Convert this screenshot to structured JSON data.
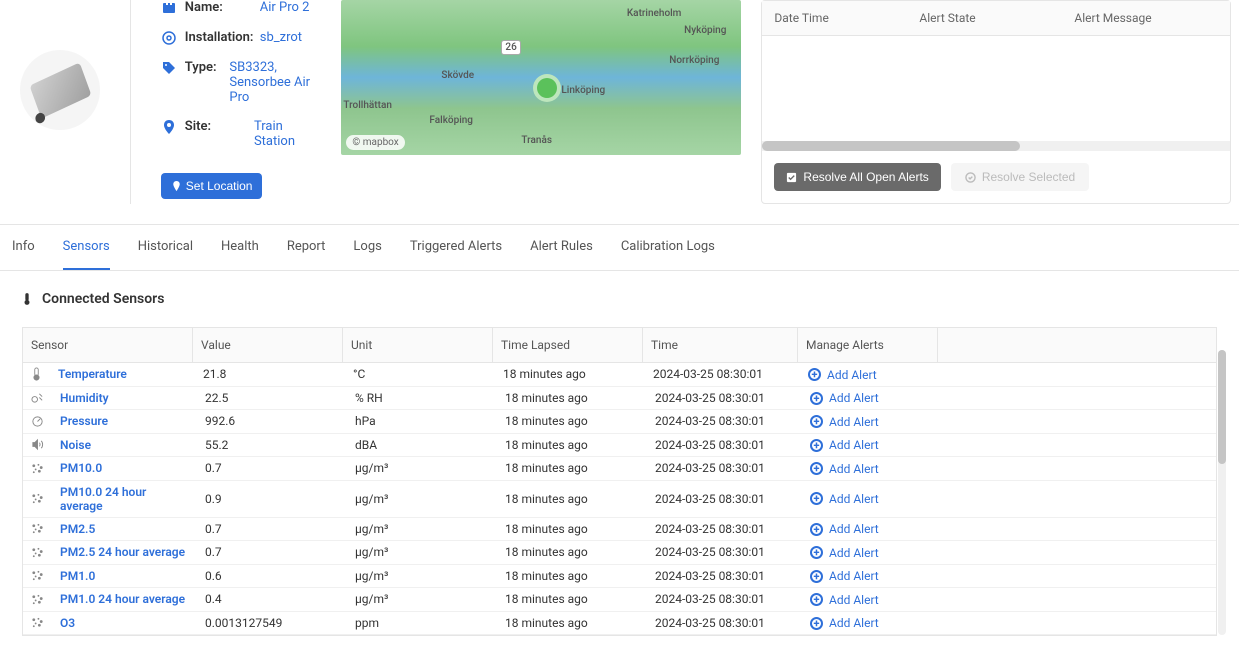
{
  "device": {
    "name_label": "Name:",
    "name": "Air Pro 2",
    "installation_label": "Installation:",
    "installation": "sb_zrot",
    "type_label": "Type:",
    "type": "SB3323, Sensorbee Air Pro",
    "site_label": "Site:",
    "site": "Train Station",
    "set_location_btn": "Set Location"
  },
  "map": {
    "attribution": "© mapbox",
    "cities": [
      "Nyköping",
      "Norrköping",
      "Linköping",
      "Skövde",
      "Falköping",
      "Trollhättan",
      "Tranås",
      "Katrineholm",
      "26"
    ]
  },
  "alerts_panel": {
    "col_datetime": "Date Time",
    "col_state": "Alert State",
    "col_message": "Alert Message",
    "resolve_all": "Resolve All Open Alerts",
    "resolve_selected": "Resolve Selected"
  },
  "tabs": {
    "info": "Info",
    "sensors": "Sensors",
    "historical": "Historical",
    "health": "Health",
    "report": "Report",
    "logs": "Logs",
    "triggered": "Triggered Alerts",
    "rules": "Alert Rules",
    "calibration": "Calibration Logs"
  },
  "sensors_section": {
    "title": "Connected Sensors",
    "headers": {
      "sensor": "Sensor",
      "value": "Value",
      "unit": "Unit",
      "lapsed": "Time Lapsed",
      "time": "Time",
      "manage": "Manage Alerts"
    },
    "add_alert_label": "Add Alert",
    "rows": [
      {
        "icon": "therm",
        "name": "Temperature",
        "value": "21.8",
        "unit": "°C",
        "lapsed": "18 minutes ago",
        "time": "2024-03-25 08:30:01"
      },
      {
        "icon": "drop",
        "name": "Humidity",
        "value": "22.5",
        "unit": "% RH",
        "lapsed": "18 minutes ago",
        "time": "2024-03-25 08:30:01"
      },
      {
        "icon": "gauge",
        "name": "Pressure",
        "value": "992.6",
        "unit": "hPa",
        "lapsed": "18 minutes ago",
        "time": "2024-03-25 08:30:01"
      },
      {
        "icon": "sound",
        "name": "Noise",
        "value": "55.2",
        "unit": "dBA",
        "lapsed": "18 minutes ago",
        "time": "2024-03-25 08:30:01"
      },
      {
        "icon": "pm",
        "name": "PM10.0",
        "value": "0.7",
        "unit": "µg/m³",
        "lapsed": "18 minutes ago",
        "time": "2024-03-25 08:30:01"
      },
      {
        "icon": "pm",
        "name": "PM10.0 24 hour average",
        "value": "0.9",
        "unit": "µg/m³",
        "lapsed": "18 minutes ago",
        "time": "2024-03-25 08:30:01"
      },
      {
        "icon": "pm",
        "name": "PM2.5",
        "value": "0.7",
        "unit": "µg/m³",
        "lapsed": "18 minutes ago",
        "time": "2024-03-25 08:30:01"
      },
      {
        "icon": "pm",
        "name": "PM2.5 24 hour average",
        "value": "0.7",
        "unit": "µg/m³",
        "lapsed": "18 minutes ago",
        "time": "2024-03-25 08:30:01"
      },
      {
        "icon": "pm",
        "name": "PM1.0",
        "value": "0.6",
        "unit": "µg/m³",
        "lapsed": "18 minutes ago",
        "time": "2024-03-25 08:30:01"
      },
      {
        "icon": "pm",
        "name": "PM1.0 24 hour average",
        "value": "0.4",
        "unit": "µg/m³",
        "lapsed": "18 minutes ago",
        "time": "2024-03-25 08:30:01"
      },
      {
        "icon": "pm",
        "name": "O3",
        "value": "0.0013127549",
        "unit": "ppm",
        "lapsed": "18 minutes ago",
        "time": "2024-03-25 08:30:01"
      }
    ]
  }
}
